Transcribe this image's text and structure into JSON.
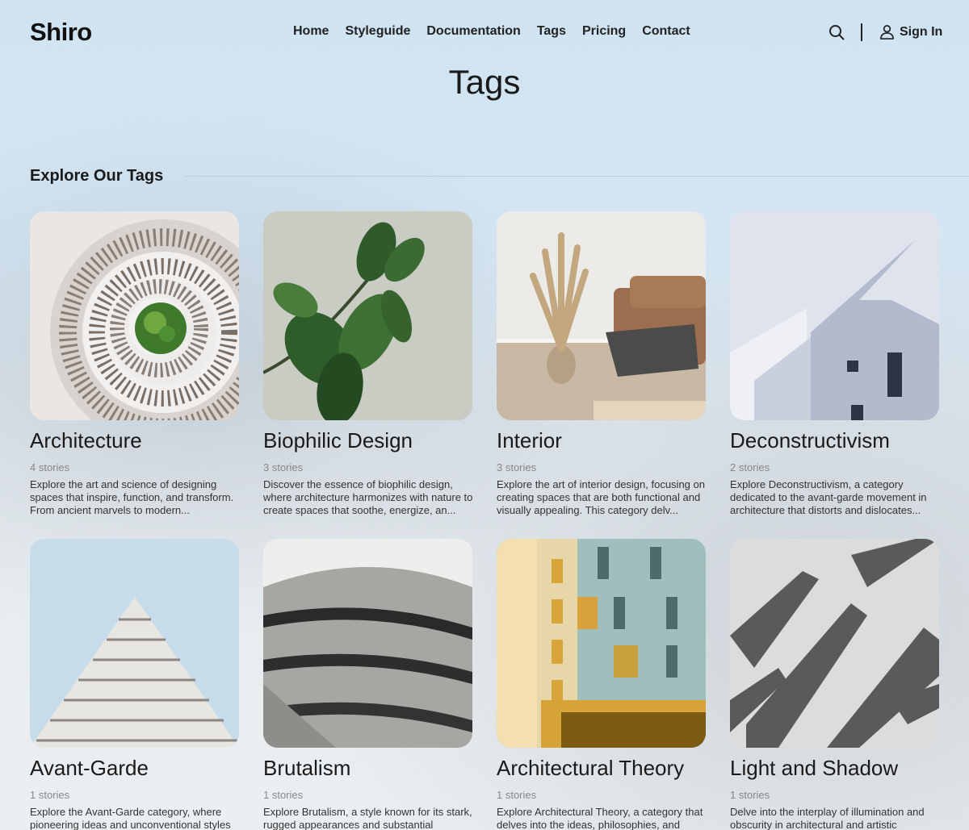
{
  "header": {
    "logo": "Shiro",
    "nav": [
      "Home",
      "Styleguide",
      "Documentation",
      "Tags",
      "Pricing",
      "Contact"
    ],
    "signin_label": "Sign In"
  },
  "page_title": "Tags",
  "section_title": "Explore Our Tags",
  "tags": [
    {
      "name": "Architecture",
      "count": "4 stories",
      "description": "Explore the art and science of designing spaces that inspire, function, and transform. From ancient marvels to modern..."
    },
    {
      "name": "Biophilic Design",
      "count": "3 stories",
      "description": "Discover the essence of biophilic design, where architecture harmonizes with nature to create spaces that soothe, energize, an..."
    },
    {
      "name": "Interior",
      "count": "3 stories",
      "description": "Explore the art of interior design, focusing on creating spaces that are both functional and visually appealing. This category delv..."
    },
    {
      "name": "Deconstructivism",
      "count": "2 stories",
      "description": "Explore Deconstructivism, a category dedicated to the avant-garde movement in architecture that distorts and dislocates..."
    },
    {
      "name": "Avant-Garde",
      "count": "1 stories",
      "description": "Explore the Avant-Garde category, where pioneering ideas and unconventional styles"
    },
    {
      "name": "Brutalism",
      "count": "1 stories",
      "description": "Explore Brutalism, a style known for its stark, rugged appearances and substantial"
    },
    {
      "name": "Architectural Theory",
      "count": "1 stories",
      "description": "Explore Architectural Theory, a category that delves into the ideas, philosophies, and"
    },
    {
      "name": "Light and Shadow",
      "count": "1 stories",
      "description": "Delve into the interplay of illumination and obscurity in architectural and artistic"
    }
  ]
}
